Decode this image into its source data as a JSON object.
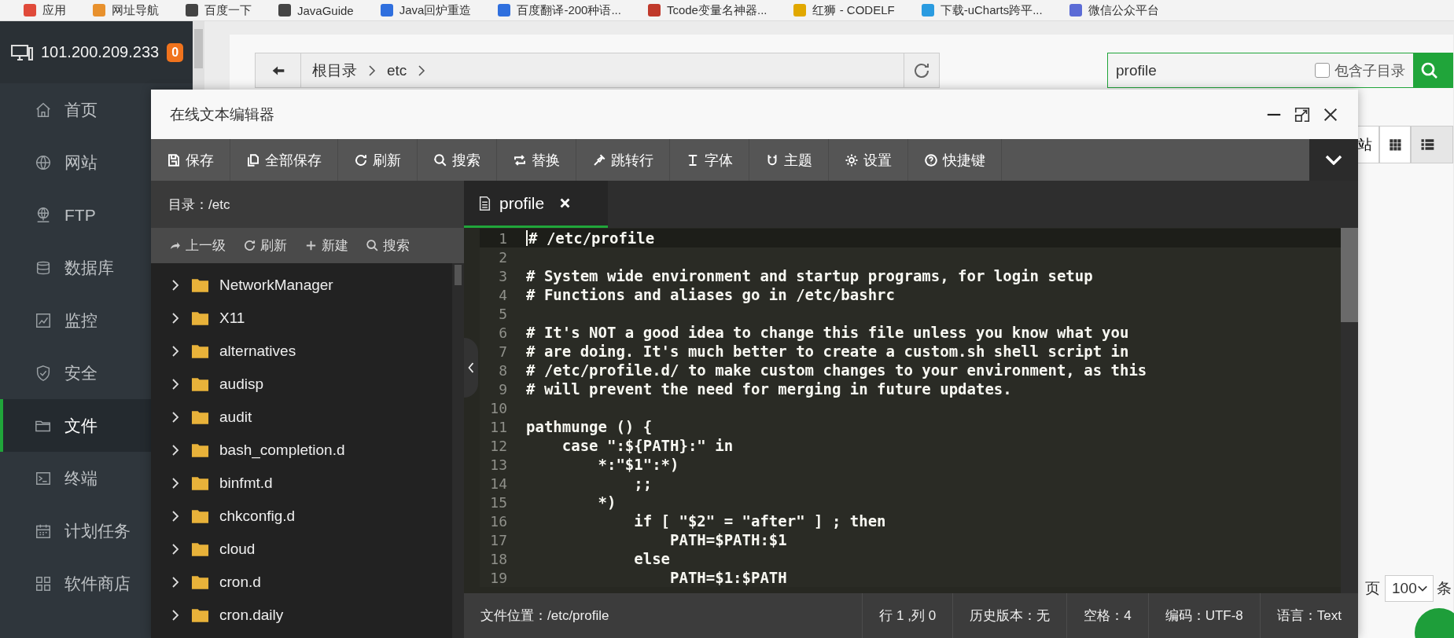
{
  "bookmarks": [
    "应用",
    "网址导航",
    "百度一下",
    "JavaGuide",
    "Java回炉重造",
    "百度翻译-200种语...",
    "Tcode变量名神器...",
    "红狮 - CODELF",
    "下载-uCharts跨平...",
    "微信公众平台"
  ],
  "server": {
    "ip": "101.200.209.233",
    "badge": "0"
  },
  "nav": [
    {
      "label": "首页",
      "selected": false
    },
    {
      "label": "网站",
      "selected": false
    },
    {
      "label": "FTP",
      "selected": false
    },
    {
      "label": "数据库",
      "selected": false
    },
    {
      "label": "监控",
      "selected": false
    },
    {
      "label": "安全",
      "selected": false
    },
    {
      "label": "文件",
      "selected": true
    },
    {
      "label": "终端",
      "selected": false
    },
    {
      "label": "计划任务",
      "selected": false
    },
    {
      "label": "软件商店",
      "selected": false
    }
  ],
  "path_bar": {
    "crumbs": [
      "根目录",
      "etc"
    ]
  },
  "search": {
    "value": "profile",
    "option": {
      "label": "包含子目录",
      "checked": false
    }
  },
  "page_behind": {
    "button": "站",
    "pager_prefix": "页",
    "page_size": "100",
    "pager_suffix": "条"
  },
  "editor": {
    "title": "在线文本编辑器",
    "toolbar": [
      "保存",
      "全部保存",
      "刷新",
      "搜索",
      "替换",
      "跳转行",
      "字体",
      "主题",
      "设置",
      "快捷键"
    ],
    "directory": "目录：/etc",
    "tree_toolbar": [
      "上一级",
      "刷新",
      "新建",
      "搜索"
    ],
    "tree": [
      {
        "name": "NetworkManager",
        "expanded": false
      },
      {
        "name": "X11",
        "expanded": false
      },
      {
        "name": "alternatives",
        "expanded": false
      },
      {
        "name": "audisp",
        "expanded": false
      },
      {
        "name": "audit",
        "expanded": false
      },
      {
        "name": "bash_completion.d",
        "expanded": false
      },
      {
        "name": "binfmt.d",
        "expanded": false
      },
      {
        "name": "chkconfig.d",
        "expanded": false
      },
      {
        "name": "cloud",
        "expanded": false
      },
      {
        "name": "cron.d",
        "expanded": false
      },
      {
        "name": "cron.daily",
        "expanded": false
      }
    ],
    "tabs": [
      {
        "label": "profile",
        "selected": true
      }
    ],
    "lines": [
      {
        "number": "1",
        "text": "# /etc/profile",
        "current": true
      },
      {
        "number": "2",
        "current": false
      },
      {
        "number": "3",
        "text": "# System wide environment and startup programs, for login setup",
        "current": false
      },
      {
        "number": "4",
        "text": "# Functions and aliases go in /etc/bashrc",
        "current": false
      },
      {
        "number": "5",
        "current": false
      },
      {
        "number": "6",
        "text": "# It's NOT a good idea to change this file unless you know what you",
        "current": false
      },
      {
        "number": "7",
        "text": "# are doing. It's much better to create a custom.sh shell script in",
        "current": false
      },
      {
        "number": "8",
        "text": "# /etc/profile.d/ to make custom changes to your environment, as this",
        "current": false
      },
      {
        "number": "9",
        "text": "# will prevent the need for merging in future updates.",
        "current": false
      },
      {
        "number": "10",
        "current": false
      },
      {
        "number": "11",
        "text": "pathmunge () {",
        "current": false
      },
      {
        "number": "12",
        "text": "    case \":${PATH}:\" in",
        "current": false
      },
      {
        "number": "13",
        "text": "        *:\"$1\":*)",
        "current": false
      },
      {
        "number": "14",
        "text": "            ;;",
        "current": false
      },
      {
        "number": "15",
        "text": "        *)",
        "current": false
      },
      {
        "number": "16",
        "text": "            if [ \"$2\" = \"after\" ] ; then",
        "current": false
      },
      {
        "number": "17",
        "text": "                PATH=$PATH:$1",
        "current": false
      },
      {
        "number": "18",
        "text": "            else",
        "current": false
      },
      {
        "number": "19",
        "text": "                PATH=$1:$PATH",
        "current": false
      }
    ],
    "status": [
      "文件位置：/etc/profile",
      "行 1 ,列 0",
      "历史版本：无",
      "空格：4",
      "编码：UTF-8",
      "语言：Text"
    ]
  }
}
